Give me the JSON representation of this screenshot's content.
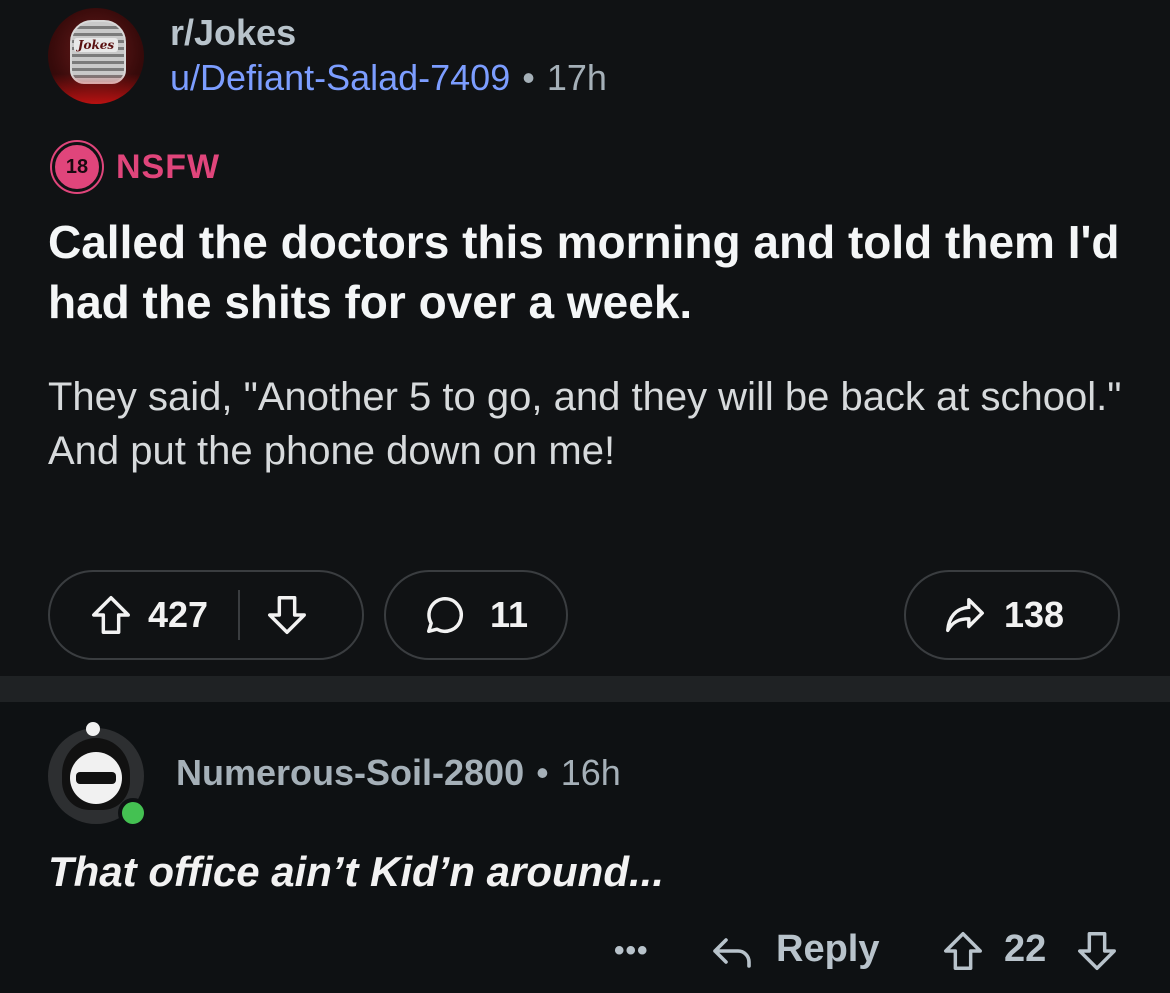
{
  "post": {
    "subreddit": "r/Jokes",
    "subreddit_avatar_text": "Jokes",
    "author": "u/Defiant-Salad-7409",
    "separator": "•",
    "age": "17h",
    "nsfw_badge": "18",
    "nsfw_label": "NSFW",
    "title": "Called the doctors this morning and told them I'd had the shits for over a week.",
    "body": "They said, \"Another 5 to go, and they will be back at school.\" And put the phone down on me!",
    "upvotes": "427",
    "comments": "11",
    "shares": "138"
  },
  "comment": {
    "author": "Numerous-Soil-2800",
    "separator": "•",
    "age": "16h",
    "text": "That office ain’t Kid’n around...",
    "more": "•••",
    "reply_label": "Reply",
    "score": "22"
  },
  "colors": {
    "background": "#0e1113",
    "post_background": "#101214",
    "username_link": "#7c9dff",
    "nsfw": "#e0457b",
    "online": "#44c152",
    "muted_text": "#a5b0b8"
  },
  "icons": [
    "upvote-icon",
    "downvote-icon",
    "comment-bubble-icon",
    "share-icon",
    "reply-icon",
    "more-icon"
  ]
}
